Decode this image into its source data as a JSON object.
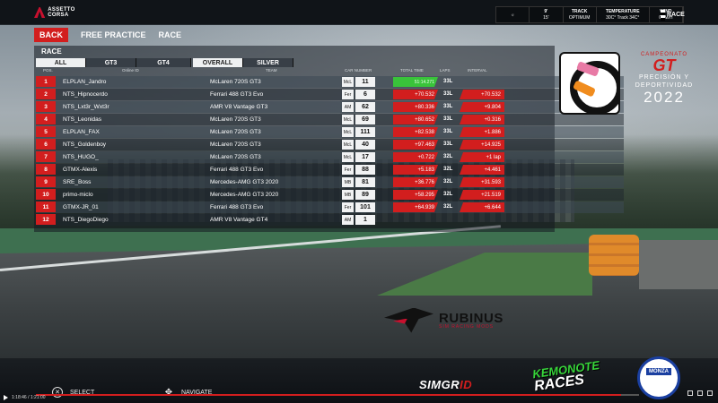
{
  "app": {
    "logo_text": "ASSETTO CORSA"
  },
  "weather": {
    "cells": [
      {
        "label": "",
        "value": "☼"
      },
      {
        "label": "9'",
        "value": "15'"
      },
      {
        "label": "TRACK",
        "value": "OPTIMUM"
      },
      {
        "label": "TEMPERATURE",
        "value": "30C° Track 34C°"
      },
      {
        "label": "WIND",
        "value": "0KM/H"
      }
    ],
    "race_chip": "RACE"
  },
  "nav": {
    "back": "BACK",
    "free_practice": "FREE PRACTICE",
    "race": "RACE"
  },
  "panel": {
    "title": "RACE",
    "tabs": [
      "ALL",
      "GT3",
      "GT4",
      "OVERALL",
      "SILVER"
    ],
    "headers": {
      "pos": "POS.",
      "online_id": "Online ID",
      "team": "TEAM",
      "car_number": "CAR NUMBER",
      "total_time": "TOTAL TIME",
      "laps": "LAPS",
      "interval": "INTERVAL"
    }
  },
  "standings": [
    {
      "pos": "1",
      "name": "ELPLAN_Jandro",
      "team": "McLaren 720S GT3",
      "badge": "McL",
      "number": "11",
      "time": "51:14.271",
      "laps": "33L",
      "interval": ""
    },
    {
      "pos": "2",
      "name": "NTS_Hipnocerdo",
      "team": "Ferrari 488 GT3 Evo",
      "badge": "Fer",
      "number": "6",
      "time": "+70.532",
      "laps": "33L",
      "interval": "+70.532"
    },
    {
      "pos": "3",
      "name": "NTS_Lxt3r_Wxt3r",
      "team": "AMR V8 Vantage GT3",
      "badge": "AM",
      "number": "62",
      "time": "+80.336",
      "laps": "33L",
      "interval": "+9.804"
    },
    {
      "pos": "4",
      "name": "NTS_Leonidas",
      "team": "McLaren 720S GT3",
      "badge": "McL",
      "number": "69",
      "time": "+80.652",
      "laps": "33L",
      "interval": "+0.316"
    },
    {
      "pos": "5",
      "name": "ELPLAN_FAX",
      "team": "McLaren 720S GT3",
      "badge": "McL",
      "number": "111",
      "time": "+82.538",
      "laps": "33L",
      "interval": "+1.886"
    },
    {
      "pos": "6",
      "name": "NTS_Goldenboy",
      "team": "McLaren 720S GT3",
      "badge": "McL",
      "number": "40",
      "time": "+97.463",
      "laps": "33L",
      "interval": "+14.925"
    },
    {
      "pos": "7",
      "name": "NTS_HUGO_",
      "team": "McLaren 720S GT3",
      "badge": "McL",
      "number": "17",
      "time": "+0.722",
      "laps": "32L",
      "interval": "+1 lap"
    },
    {
      "pos": "8",
      "name": "GTMX-Alexis",
      "team": "Ferrari 488 GT3 Evo",
      "badge": "Fer",
      "number": "88",
      "time": "+5.183",
      "laps": "32L",
      "interval": "+4.461"
    },
    {
      "pos": "9",
      "name": "SRE_Boss",
      "team": "Mercedes-AMG GT3 2020",
      "badge": "MB",
      "number": "81",
      "time": "+36.776",
      "laps": "32L",
      "interval": "+31.593"
    },
    {
      "pos": "10",
      "name": "primo-miclo",
      "team": "Mercedes-AMG GT3 2020",
      "badge": "MB",
      "number": "89",
      "time": "+58.295",
      "laps": "32L",
      "interval": "+21.519"
    },
    {
      "pos": "11",
      "name": "GTMX-JR_01",
      "team": "Ferrari 488 GT3 Evo",
      "badge": "Fer",
      "number": "101",
      "time": "+64.939",
      "laps": "32L",
      "interval": "+6.644"
    },
    {
      "pos": "12",
      "name": "NTS_DiegoDiego",
      "team": "AMR V8 Vantage GT4",
      "badge": "AM",
      "number": "1",
      "time": "",
      "laps": "",
      "interval": ""
    }
  ],
  "championship": {
    "small": "CAMPEONATO",
    "mark": "GT",
    "line1": "PRECISIÓN Y",
    "line2": "DEPORTIVIDAD",
    "year": "2022"
  },
  "sponsor": {
    "name": "RUBINUS",
    "sub": "SIM RACING MODS"
  },
  "footer": {
    "select": "SELECT",
    "navigate": "NAVIGATE",
    "simgrid_a": "SIMGR",
    "simgrid_b": "ID",
    "kemonote_1": "KEMONOTE",
    "kemonote_2": "RACES",
    "monza": "MONZA"
  },
  "player": {
    "time": "1:18:46 / 1:21:00",
    "progress": 0.97
  },
  "colors": {
    "accent_red": "#d21e1e",
    "best_green": "#39c33a",
    "panel_row": "#3c4854"
  }
}
